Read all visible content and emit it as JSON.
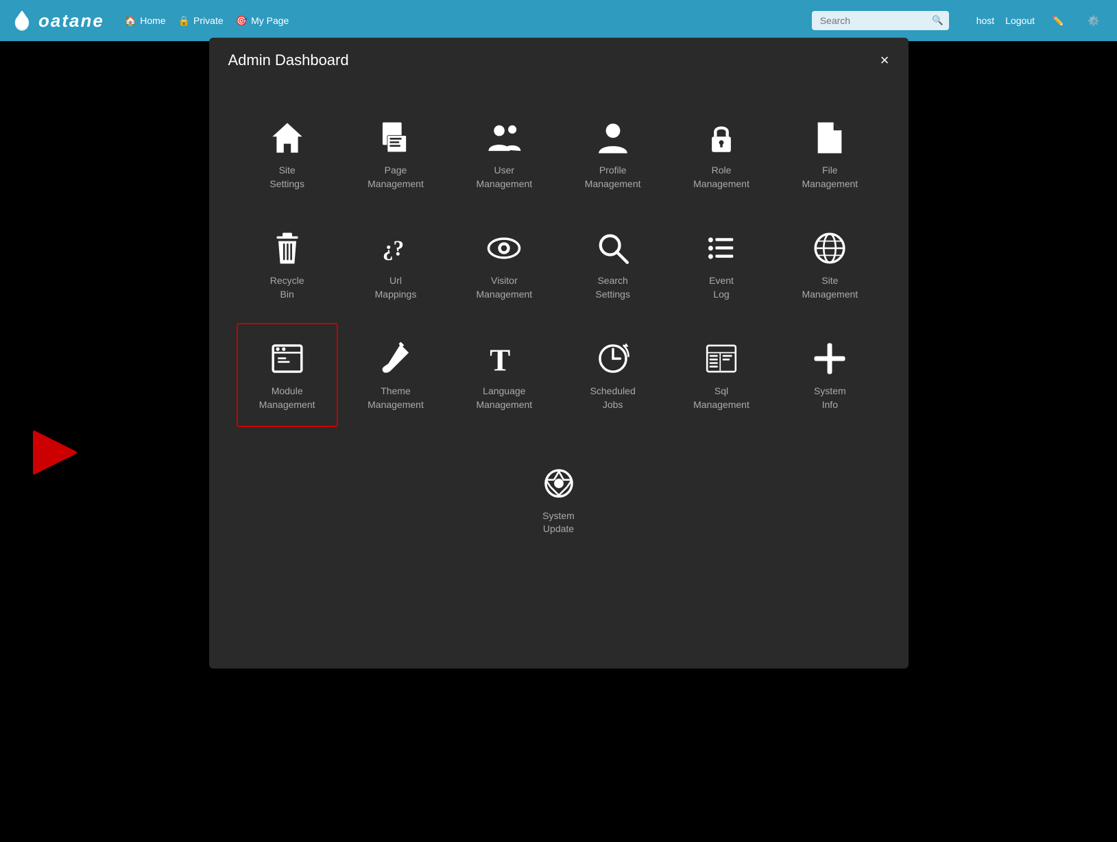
{
  "navbar": {
    "logo_text": "oatane",
    "nav_items": [
      {
        "label": "Home",
        "icon": "home"
      },
      {
        "label": "Private",
        "icon": "lock"
      },
      {
        "label": "My Page",
        "icon": "target"
      }
    ],
    "search_placeholder": "Search",
    "user": "host",
    "logout_label": "Logout"
  },
  "modal": {
    "title": "Admin Dashboard",
    "close_label": "×",
    "items": [
      {
        "id": "site-settings",
        "label": "Site\nSettings",
        "icon": "home"
      },
      {
        "id": "page-management",
        "label": "Page\nManagement",
        "icon": "page"
      },
      {
        "id": "user-management",
        "label": "User\nManagement",
        "icon": "users"
      },
      {
        "id": "profile-management",
        "label": "Profile\nManagement",
        "icon": "profile"
      },
      {
        "id": "role-management",
        "label": "Role\nManagement",
        "icon": "lock"
      },
      {
        "id": "file-management",
        "label": "File\nManagement",
        "icon": "file"
      },
      {
        "id": "recycle-bin",
        "label": "Recycle\nBin",
        "icon": "trash"
      },
      {
        "id": "url-mappings",
        "label": "Url\nMappings",
        "icon": "url"
      },
      {
        "id": "visitor-management",
        "label": "Visitor\nManagement",
        "icon": "eye"
      },
      {
        "id": "search-settings",
        "label": "Search\nSettings",
        "icon": "search"
      },
      {
        "id": "event-log",
        "label": "Event\nLog",
        "icon": "list"
      },
      {
        "id": "site-management",
        "label": "Site\nManagement",
        "icon": "globe"
      },
      {
        "id": "module-management",
        "label": "Module\nManagement",
        "icon": "module",
        "highlighted": true
      },
      {
        "id": "theme-management",
        "label": "Theme\nManagement",
        "icon": "brush"
      },
      {
        "id": "language-management",
        "label": "Language\nManagement",
        "icon": "font"
      },
      {
        "id": "scheduled-jobs",
        "label": "Scheduled\nJobs",
        "icon": "scheduled"
      },
      {
        "id": "sql-management",
        "label": "Sql\nManagement",
        "icon": "sqllist"
      },
      {
        "id": "system-info",
        "label": "System\nInfo",
        "icon": "plus"
      },
      {
        "id": "system-update",
        "label": "System\nUpdate",
        "icon": "shutter"
      }
    ]
  }
}
